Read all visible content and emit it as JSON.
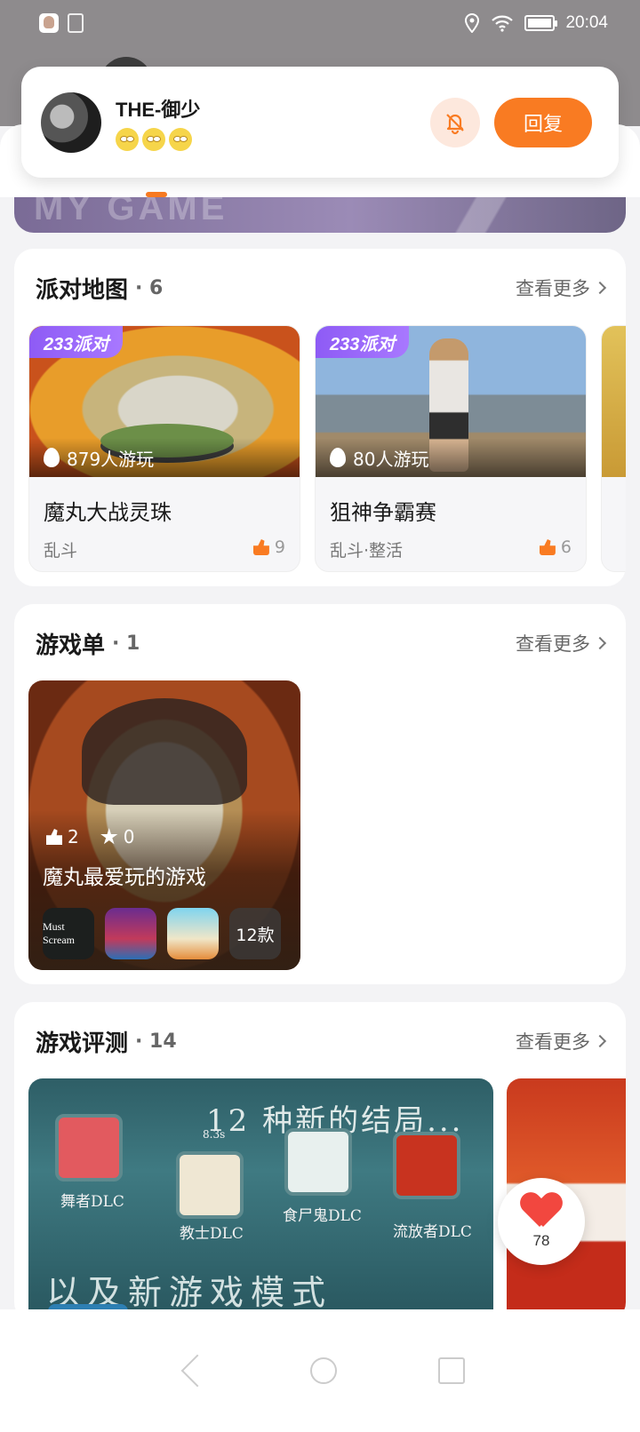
{
  "status_bar": {
    "time": "20:04",
    "icons": [
      "app-avatar-icon",
      "document-icon",
      "location-icon",
      "wifi-icon",
      "battery-icon"
    ],
    "battery_level": 0.9
  },
  "notification": {
    "sender": "THE-御少",
    "message_emojis": [
      "rolling-eyes-emoji",
      "rolling-eyes-emoji",
      "rolling-eyes-emoji"
    ],
    "mute_icon": "bell-off-icon",
    "reply_label": "回复"
  },
  "banner": {
    "text": "MY GAME"
  },
  "party_maps": {
    "title": "派对地图",
    "count": "· 6",
    "more_label": "查看更多",
    "badge": "233派对",
    "items": [
      {
        "name": "魔丸大战灵珠",
        "players": "879人游玩",
        "tags": "乱斗",
        "likes": "9"
      },
      {
        "name": "狙神争霸赛",
        "players": "80人游玩",
        "tags": "乱斗·整活",
        "likes": "6"
      }
    ]
  },
  "game_lists": {
    "title": "游戏单",
    "count": "· 1",
    "more_label": "查看更多",
    "items": [
      {
        "title": "魔丸最爱玩的游戏",
        "likes": "2",
        "favorites": "0",
        "game_count": "12款",
        "game_icons": [
          "Must Scream",
          "security-game",
          "party-game"
        ]
      }
    ]
  },
  "reviews": {
    "title": "游戏评测",
    "count": "· 14",
    "more_label": "查看更多",
    "main_image": {
      "endings_text": "12 种新的结局...",
      "mode_text": "以及新游戏模式",
      "timer": "8.3s",
      "dlc_labels": [
        "舞者DLC",
        "教士DLC",
        "食尸鬼DLC",
        "流放者DLC"
      ]
    }
  },
  "like_fab": {
    "count": "78"
  },
  "colors": {
    "accent": "#f97b22",
    "badge_purple": "#8e5bf5",
    "like_red": "#f2473f"
  }
}
